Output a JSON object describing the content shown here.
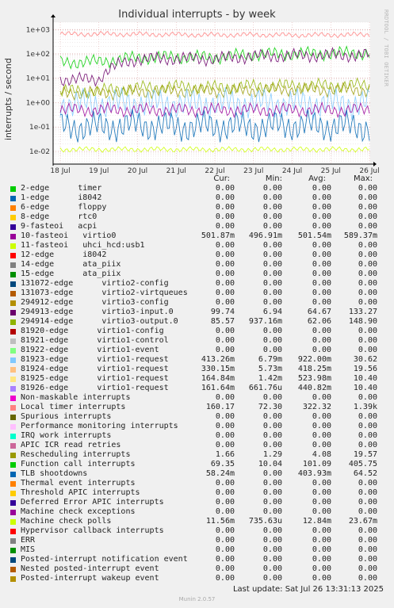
{
  "title": "Individual interrupts - by week",
  "side_text": "RRDTOOL / TOBI OETIKER",
  "legend_headers": {
    "cur": "Cur:",
    "min": "Min:",
    "avg": "Avg:",
    "max": "Max:"
  },
  "legend": [
    {
      "name": "2-edge      timer",
      "color": "#00cc00",
      "cur": "0.00",
      "min": "0.00",
      "avg": "0.00",
      "max": "0.00"
    },
    {
      "name": "1-edge      i8042",
      "color": "#0066b3",
      "cur": "0.00",
      "min": "0.00",
      "avg": "0.00",
      "max": "0.00"
    },
    {
      "name": "6-edge      floppy",
      "color": "#ff8000",
      "cur": "0.00",
      "min": "0.00",
      "avg": "0.00",
      "max": "0.00"
    },
    {
      "name": "8-edge      rtc0",
      "color": "#ffcc00",
      "cur": "0.00",
      "min": "0.00",
      "avg": "0.00",
      "max": "0.00"
    },
    {
      "name": "9-fasteoi   acpi",
      "color": "#330099",
      "cur": "0.00",
      "min": "0.00",
      "avg": "0.00",
      "max": "0.00"
    },
    {
      "name": "10-fasteoi   virtio0",
      "color": "#990099",
      "cur": "501.87m",
      "min": "496.91m",
      "avg": "501.54m",
      "max": "589.37m"
    },
    {
      "name": "11-fasteoi   uhci_hcd:usb1",
      "color": "#ccff00",
      "cur": "0.00",
      "min": "0.00",
      "avg": "0.00",
      "max": "0.00"
    },
    {
      "name": "12-edge      i8042",
      "color": "#ff0000",
      "cur": "0.00",
      "min": "0.00",
      "avg": "0.00",
      "max": "0.00"
    },
    {
      "name": "14-edge      ata_piix",
      "color": "#808080",
      "cur": "0.00",
      "min": "0.00",
      "avg": "0.00",
      "max": "0.00"
    },
    {
      "name": "15-edge      ata_piix",
      "color": "#008f00",
      "cur": "0.00",
      "min": "0.00",
      "avg": "0.00",
      "max": "0.00"
    },
    {
      "name": "131072-edge      virtio2-config",
      "color": "#00487d",
      "cur": "0.00",
      "min": "0.00",
      "avg": "0.00",
      "max": "0.00"
    },
    {
      "name": "131073-edge      virtio2-virtqueues",
      "color": "#b35a00",
      "cur": "0.00",
      "min": "0.00",
      "avg": "0.00",
      "max": "0.00"
    },
    {
      "name": "294912-edge      virtio3-config",
      "color": "#b38f00",
      "cur": "0.00",
      "min": "0.00",
      "avg": "0.00",
      "max": "0.00"
    },
    {
      "name": "294913-edge      virtio3-input.0",
      "color": "#6b006b",
      "cur": "99.74",
      "min": "6.94",
      "avg": "64.67",
      "max": "133.27"
    },
    {
      "name": "294914-edge      virtio3-output.0",
      "color": "#8fb300",
      "cur": "85.57",
      "min": "937.16m",
      "avg": "62.06",
      "max": "148.90"
    },
    {
      "name": "81920-edge      virtio1-config",
      "color": "#b30000",
      "cur": "0.00",
      "min": "0.00",
      "avg": "0.00",
      "max": "0.00"
    },
    {
      "name": "81921-edge      virtio1-control",
      "color": "#bebebe",
      "cur": "0.00",
      "min": "0.00",
      "avg": "0.00",
      "max": "0.00"
    },
    {
      "name": "81922-edge      virtio1-event",
      "color": "#80ff80",
      "cur": "0.00",
      "min": "0.00",
      "avg": "0.00",
      "max": "0.00"
    },
    {
      "name": "81923-edge      virtio1-request",
      "color": "#80c9ff",
      "cur": "413.26m",
      "min": "6.79m",
      "avg": "922.00m",
      "max": "30.62"
    },
    {
      "name": "81924-edge      virtio1-request",
      "color": "#ffc080",
      "cur": "330.15m",
      "min": "5.73m",
      "avg": "418.25m",
      "max": "19.56"
    },
    {
      "name": "81925-edge      virtio1-request",
      "color": "#ffe680",
      "cur": "164.84m",
      "min": "1.42m",
      "avg": "523.98m",
      "max": "10.40"
    },
    {
      "name": "81926-edge      virtio1-request",
      "color": "#aa80ff",
      "cur": "161.64m",
      "min": "661.76u",
      "avg": "440.82m",
      "max": "10.40"
    },
    {
      "name": "Non-maskable interrupts",
      "color": "#ee00cc",
      "cur": "0.00",
      "min": "0.00",
      "avg": "0.00",
      "max": "0.00"
    },
    {
      "name": "Local timer interrupts",
      "color": "#ff8080",
      "cur": "160.17",
      "min": "72.30",
      "avg": "322.32",
      "max": "1.39k"
    },
    {
      "name": "Spurious interrupts",
      "color": "#666600",
      "cur": "0.00",
      "min": "0.00",
      "avg": "0.00",
      "max": "0.00"
    },
    {
      "name": "Performance monitoring interrupts",
      "color": "#ffbfff",
      "cur": "0.00",
      "min": "0.00",
      "avg": "0.00",
      "max": "0.00"
    },
    {
      "name": "IRQ work interrupts",
      "color": "#00ffcc",
      "cur": "0.00",
      "min": "0.00",
      "avg": "0.00",
      "max": "0.00"
    },
    {
      "name": "APIC ICR read retries",
      "color": "#cc6699",
      "cur": "0.00",
      "min": "0.00",
      "avg": "0.00",
      "max": "0.00"
    },
    {
      "name": "Rescheduling interrupts",
      "color": "#999900",
      "cur": "1.66",
      "min": "1.29",
      "avg": "4.08",
      "max": "19.57"
    },
    {
      "name": "Function call interrupts",
      "color": "#00cc00",
      "cur": "69.35",
      "min": "10.04",
      "avg": "101.09",
      "max": "405.75"
    },
    {
      "name": "TLB shootdowns",
      "color": "#0066b3",
      "cur": "58.24m",
      "min": "0.00",
      "avg": "403.93m",
      "max": "64.52"
    },
    {
      "name": "Thermal event interrupts",
      "color": "#ff8000",
      "cur": "0.00",
      "min": "0.00",
      "avg": "0.00",
      "max": "0.00"
    },
    {
      "name": "Threshold APIC interrupts",
      "color": "#ffcc00",
      "cur": "0.00",
      "min": "0.00",
      "avg": "0.00",
      "max": "0.00"
    },
    {
      "name": "Deferred Error APIC interrupts",
      "color": "#330099",
      "cur": "0.00",
      "min": "0.00",
      "avg": "0.00",
      "max": "0.00"
    },
    {
      "name": "Machine check exceptions",
      "color": "#990099",
      "cur": "0.00",
      "min": "0.00",
      "avg": "0.00",
      "max": "0.00"
    },
    {
      "name": "Machine check polls",
      "color": "#ccff00",
      "cur": "11.56m",
      "min": "735.63u",
      "avg": "12.84m",
      "max": "23.67m"
    },
    {
      "name": "Hypervisor callback interrupts",
      "color": "#ff0000",
      "cur": "0.00",
      "min": "0.00",
      "avg": "0.00",
      "max": "0.00"
    },
    {
      "name": "ERR",
      "color": "#808080",
      "cur": "0.00",
      "min": "0.00",
      "avg": "0.00",
      "max": "0.00"
    },
    {
      "name": "MIS",
      "color": "#008f00",
      "cur": "0.00",
      "min": "0.00",
      "avg": "0.00",
      "max": "0.00"
    },
    {
      "name": "Posted-interrupt notification event",
      "color": "#00487d",
      "cur": "0.00",
      "min": "0.00",
      "avg": "0.00",
      "max": "0.00"
    },
    {
      "name": "Nested posted-interrupt event",
      "color": "#b35a00",
      "cur": "0.00",
      "min": "0.00",
      "avg": "0.00",
      "max": "0.00"
    },
    {
      "name": "Posted-interrupt wakeup event",
      "color": "#b38f00",
      "cur": "0.00",
      "min": "0.00",
      "avg": "0.00",
      "max": "0.00"
    }
  ],
  "last_update": "Last update: Sat Jul 26 13:31:13 2025",
  "munin_version": "Munin 2.0.57",
  "chart_data": {
    "type": "line",
    "title": "Individual interrupts - by week",
    "ylabel": "interrupts / second",
    "y_scale": "log",
    "ylim": [
      0.003,
      2000
    ],
    "y_ticks": [
      "1e-02",
      "1e-01",
      "1e+00",
      "1e+01",
      "1e+02",
      "1e+03"
    ],
    "x": [
      "18 Jul",
      "19 Jul",
      "20 Jul",
      "21 Jul",
      "22 Jul",
      "23 Jul",
      "24 Jul",
      "25 Jul",
      "26 Jul"
    ],
    "grid": true,
    "series": [
      {
        "name": "Local timer interrupts",
        "color": "#ff8080",
        "values": [
          650,
          660,
          640,
          620,
          600,
          610,
          590,
          600,
          620
        ]
      },
      {
        "name": "Function call interrupts",
        "color": "#00cc00",
        "values": [
          45,
          48,
          70,
          75,
          72,
          95,
          100,
          105,
          110
        ]
      },
      {
        "name": "294913-edge      virtio3-input.0",
        "color": "#6b006b",
        "values": [
          9,
          9,
          60,
          65,
          62,
          80,
          85,
          88,
          90
        ]
      },
      {
        "name": "294914-edge      virtio3-output.0",
        "color": "#8fb300",
        "values": [
          3,
          3,
          4,
          4.5,
          4.2,
          4.8,
          5,
          5,
          5.2
        ]
      },
      {
        "name": "Rescheduling interrupts",
        "color": "#999900",
        "values": [
          2.5,
          2.5,
          2.8,
          3,
          3,
          3.2,
          3.5,
          3.4,
          3.3
        ]
      },
      {
        "name": "81923-edge      virtio1-request",
        "color": "#80c9ff",
        "values": [
          0.9,
          0.9,
          0.95,
          0.9,
          0.92,
          0.93,
          0.9,
          0.91,
          0.92
        ]
      },
      {
        "name": "10-fasteoi   virtio0",
        "color": "#990099",
        "values": [
          0.5,
          0.5,
          0.5,
          0.5,
          0.5,
          0.5,
          0.5,
          0.5,
          0.5
        ]
      },
      {
        "name": "TLB shootdowns",
        "color": "#0066b3",
        "values": [
          0.1,
          0.1,
          0.12,
          0.1,
          0.11,
          0.1,
          0.12,
          0.11,
          0.1
        ]
      },
      {
        "name": "Machine check polls",
        "color": "#ccff00",
        "values": [
          0.012,
          0.012,
          0.012,
          0.012,
          0.012,
          0.012,
          0.012,
          0.012,
          0.012
        ]
      }
    ]
  }
}
